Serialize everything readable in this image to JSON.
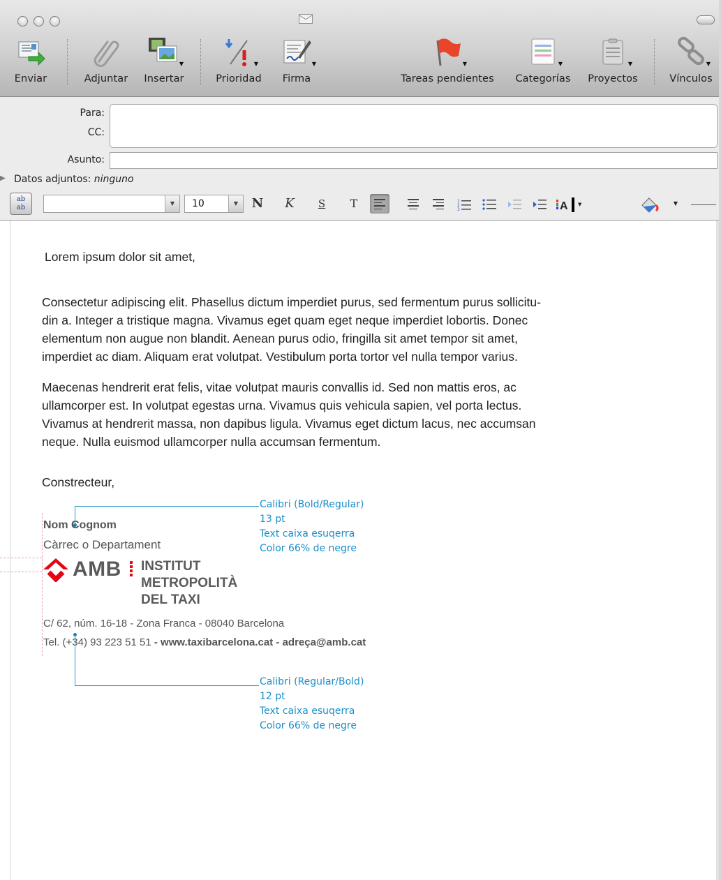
{
  "toolbar": {
    "send": "Enviar",
    "attach": "Adjuntar",
    "insert": "Insertar",
    "priority": "Prioridad",
    "signature": "Firma",
    "tasks": "Tareas pendientes",
    "categories": "Categorías",
    "projects": "Proyectos",
    "links": "Vínculos"
  },
  "header": {
    "to_label": "Para:",
    "cc_label": "CC:",
    "subject_label": "Asunto:",
    "to_value": "",
    "cc_value": "",
    "subject_value": "",
    "attachments_label": "Datos adjuntos:",
    "attachments_value": "ninguno"
  },
  "format": {
    "font_name": "",
    "font_size": "10",
    "bold": "N",
    "italic": "K",
    "underline": "S",
    "text": "T"
  },
  "message": {
    "greeting": "Lorem ipsum dolor sit amet,",
    "para1": [
      "Consectetur adipiscing elit. Phasellus dictum imperdiet purus, sed fermentum purus sollicitu-",
      "din a. Integer a tristique magna. Vivamus eget quam eget neque imperdiet lobortis. Donec",
      "elementum non augue non blandit. Aenean purus odio, fringilla sit amet tempor sit amet,",
      "imperdiet ac diam. Aliquam erat volutpat. Vestibulum porta tortor vel nulla tempor varius."
    ],
    "para2": [
      "Maecenas hendrerit erat felis, vitae volutpat mauris convallis id. Sed non mattis eros, ac",
      "ullamcorper est. In volutpat egestas urna. Vivamus quis vehicula sapien, vel porta lectus.",
      "Vivamus at hendrerit massa, non dapibus ligula. Vivamus eget dictum lacus, nec accumsan",
      "neque. Nulla euismod ullamcorper nulla accumsan fermentum."
    ],
    "closing": "Constrecteur,"
  },
  "signature": {
    "name": "Nom Cognom",
    "role": "Càrrec o Departament",
    "logo_amb": "AMB",
    "logo_line1": "INSTITUT",
    "logo_line2": "METROPOLITÀ",
    "logo_line3": "DEL TAXI",
    "address": "C/ 62, núm. 16-18 - Zona Franca - 08040 Barcelona",
    "phone": "Tel. (+34) 93 223 51 51",
    "sep": " - ",
    "web": "www.taxibarcelona.cat",
    "email": "adreça@amb.cat"
  },
  "annotations": {
    "top": [
      "Calibri (Bold/Regular)",
      "13 pt",
      "Text caixa esuqerra",
      "Color 66% de negre"
    ],
    "bottom": [
      "Calibri (Regular/Bold)",
      "12 pt",
      "Text caixa esuqerra",
      "Color 66% de negre"
    ]
  },
  "colors": {
    "annotation": "#1a8fc9",
    "logo_red": "#e30613",
    "signature_text": "#555555"
  }
}
